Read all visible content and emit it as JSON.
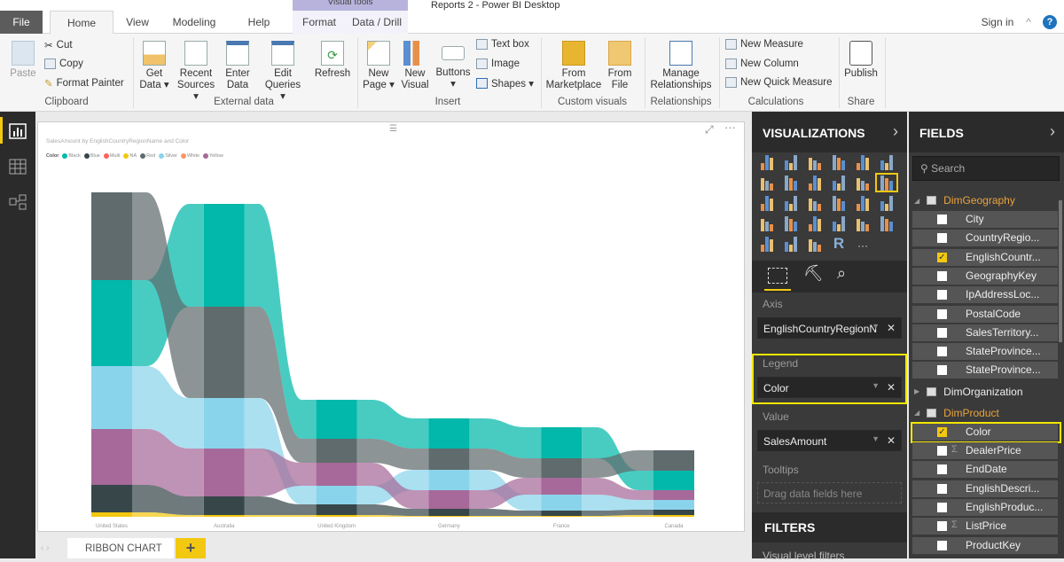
{
  "window": {
    "title": "Reports 2 - Power BI Desktop",
    "context_group": "Visual tools",
    "sign_in": "Sign in"
  },
  "tabs": [
    "File",
    "Home",
    "View",
    "Modeling",
    "Help",
    "Format",
    "Data / Drill"
  ],
  "ribbon": {
    "clipboard": {
      "paste": "Paste",
      "cut": "Cut",
      "copy": "Copy",
      "format_painter": "Format Painter",
      "group": "Clipboard"
    },
    "external": {
      "get_data": [
        "Get",
        "Data ▾"
      ],
      "recent": [
        "Recent",
        "Sources ▾"
      ],
      "enter": [
        "Enter",
        "Data"
      ],
      "edit": [
        "Edit",
        "Queries ▾"
      ],
      "refresh": "Refresh",
      "group": "External data"
    },
    "insert": {
      "new_page": [
        "New",
        "Page ▾"
      ],
      "new_visual": [
        "New",
        "Visual"
      ],
      "buttons": [
        "Buttons",
        "▾"
      ],
      "text_box": "Text box",
      "image": "Image",
      "shapes": "Shapes ▾",
      "group": "Insert"
    },
    "custom": {
      "marketplace": [
        "From",
        "Marketplace"
      ],
      "file": [
        "From",
        "File"
      ],
      "group": "Custom visuals"
    },
    "relationships": {
      "manage": [
        "Manage",
        "Relationships"
      ],
      "group": "Relationships"
    },
    "calc": {
      "new_measure": "New Measure",
      "new_column": "New Column",
      "new_quick": "New Quick Measure",
      "group": "Calculations"
    },
    "share": {
      "publish": "Publish",
      "group": "Share"
    }
  },
  "visual": {
    "title": "SalesAmount by EnglishCountryRegionName and Color"
  },
  "chart_data": {
    "type": "ribbon",
    "title": "SalesAmount by EnglishCountryRegionName and Color",
    "legend_title": "Color",
    "legend_position": "top-left",
    "categories": [
      "United States",
      "Australia",
      "United Kingdom",
      "Germany",
      "France",
      "Canada"
    ],
    "series": [
      {
        "name": "Black",
        "color": "#01B8AA",
        "values": [
          97,
          116,
          44,
          34,
          35,
          22
        ]
      },
      {
        "name": "Blue",
        "color": "#374649",
        "values": [
          31,
          21,
          12,
          8,
          6,
          6
        ]
      },
      {
        "name": "Multi",
        "color": "#FD625E",
        "values": [
          0,
          0,
          0,
          0,
          0,
          0
        ]
      },
      {
        "name": "NA",
        "color": "#F2C80F",
        "values": [
          5,
          2,
          2,
          1,
          1,
          2
        ]
      },
      {
        "name": "Red",
        "color": "#5F6B6D",
        "values": [
          99,
          103,
          27,
          24,
          22,
          23
        ]
      },
      {
        "name": "Silver",
        "color": "#8AD4EB",
        "values": [
          71,
          57,
          21,
          23,
          18,
          11
        ]
      },
      {
        "name": "White",
        "color": "#FE9666",
        "values": [
          0,
          0,
          0,
          0,
          0,
          0
        ]
      },
      {
        "name": "Yellow",
        "color": "#A66999",
        "values": [
          63,
          54,
          26,
          21,
          19,
          11
        ]
      }
    ],
    "ylabel": "SalesAmount",
    "xlabel": "EnglishCountryRegionName"
  },
  "pages": {
    "tab": "RIBBON CHART",
    "add": "+"
  },
  "viz": {
    "title": "VISUALIZATIONS",
    "icons": [
      "stacked-bar",
      "stacked-column",
      "clustered-bar",
      "clustered-column",
      "100-bar",
      "100-column",
      "line",
      "area",
      "stacked-area",
      "line-stacked-column",
      "line-clustered-column",
      "ribbon",
      "waterfall",
      "scatter",
      "pie",
      "donut",
      "treemap",
      "map",
      "filled-map",
      "funnel",
      "gauge",
      "card",
      "multi-row-card",
      "kpi",
      "slicer",
      "table",
      "matrix",
      "r-visual",
      "more"
    ],
    "r_label": "R",
    "more_label": "···",
    "axis_label": "Axis",
    "axis_value": "EnglishCountryRegionN",
    "legend_label": "Legend",
    "legend_value": "Color",
    "value_label": "Value",
    "value_value": "SalesAmount",
    "tooltips_label": "Tooltips",
    "tooltips_placeholder": "Drag data fields here",
    "filters_title": "FILTERS",
    "filters_sub": "Visual level filters"
  },
  "fields": {
    "title": "FIELDS",
    "search_placeholder": "Search",
    "tables": [
      {
        "name": "DimGeography",
        "expanded": true,
        "fields": [
          {
            "name": "City",
            "checked": false
          },
          {
            "name": "CountryRegio...",
            "checked": false
          },
          {
            "name": "EnglishCountr...",
            "checked": true
          },
          {
            "name": "GeographyKey",
            "checked": false
          },
          {
            "name": "IpAddressLoc...",
            "checked": false
          },
          {
            "name": "PostalCode",
            "checked": false
          },
          {
            "name": "SalesTerritory...",
            "checked": false
          },
          {
            "name": "StateProvince...",
            "checked": false
          },
          {
            "name": "StateProvince...",
            "checked": false
          }
        ]
      },
      {
        "name": "DimOrganization",
        "expanded": false,
        "fields": []
      },
      {
        "name": "DimProduct",
        "expanded": true,
        "fields": [
          {
            "name": "Color",
            "checked": true
          },
          {
            "name": "DealerPrice",
            "checked": false,
            "sigma": true
          },
          {
            "name": "EndDate",
            "checked": false
          },
          {
            "name": "EnglishDescri...",
            "checked": false
          },
          {
            "name": "EnglishProduc...",
            "checked": false
          },
          {
            "name": "ListPrice",
            "checked": false,
            "sigma": true
          },
          {
            "name": "ProductKey",
            "checked": false
          }
        ]
      }
    ]
  },
  "colors": {
    "accent": "#F2C811",
    "highlight": "#F2E600",
    "table_header": "#E8A33D"
  }
}
